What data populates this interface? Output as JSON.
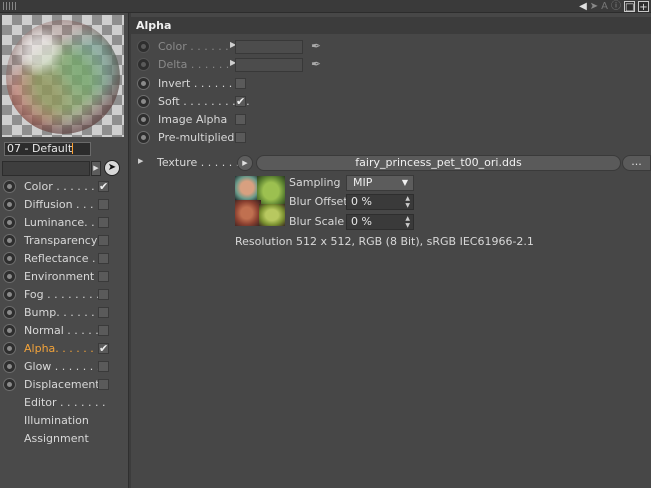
{
  "material": {
    "name": "07 - Default"
  },
  "channels": [
    {
      "label": "Color . . . . . . .",
      "checked": true,
      "active": false
    },
    {
      "label": "Diffusion . . . .",
      "checked": false,
      "active": false
    },
    {
      "label": "Luminance. . . .",
      "checked": false,
      "active": false
    },
    {
      "label": "Transparency",
      "checked": false,
      "active": false
    },
    {
      "label": "Reflectance . . .",
      "checked": false,
      "active": false
    },
    {
      "label": "Environment",
      "checked": false,
      "active": false
    },
    {
      "label": "Fog . . . . . . . .",
      "checked": false,
      "active": false
    },
    {
      "label": "Bump. . . . . . .",
      "checked": false,
      "active": false
    },
    {
      "label": "Normal . . . . . .",
      "checked": false,
      "active": false
    },
    {
      "label": "Alpha. . . . . . . .",
      "checked": true,
      "active": true
    },
    {
      "label": "Glow . . . . . . . .",
      "checked": false,
      "active": false
    },
    {
      "label": "Displacement",
      "checked": false,
      "active": false
    },
    {
      "label": "Editor . . . . . . .",
      "checked": null,
      "active": false
    },
    {
      "label": "Illumination",
      "checked": null,
      "active": false
    },
    {
      "label": "Assignment",
      "checked": null,
      "active": false
    }
  ],
  "panel": {
    "title": "Alpha",
    "color_label": "Color . . . . . .",
    "delta_label": "Delta . . . . . .",
    "invert_label": "Invert . . . . . . . .",
    "soft_label": "Soft . . . . . . . . . .",
    "soft_checked": true,
    "image_alpha_label": "Image Alpha",
    "premultiplied_label": "Pre-multiplied",
    "texture_label": "Texture . . . . . .",
    "texture_file": "fairy_princess_pet_t00_ori.dds",
    "more_label": "...",
    "sampling_label": "Sampling",
    "sampling_value": "MIP",
    "blur_offset_label": "Blur Offset",
    "blur_offset_value": "0 %",
    "blur_scale_label": "Blur Scale",
    "blur_scale_value": "0 %",
    "resolution_text": "Resolution 512 x 512, RGB (8 Bit), sRGB IEC61966-2.1"
  },
  "colors": {
    "accent": "#f2a33a",
    "background": "#4a4a4a",
    "panel_header": "#3c3c3c"
  }
}
